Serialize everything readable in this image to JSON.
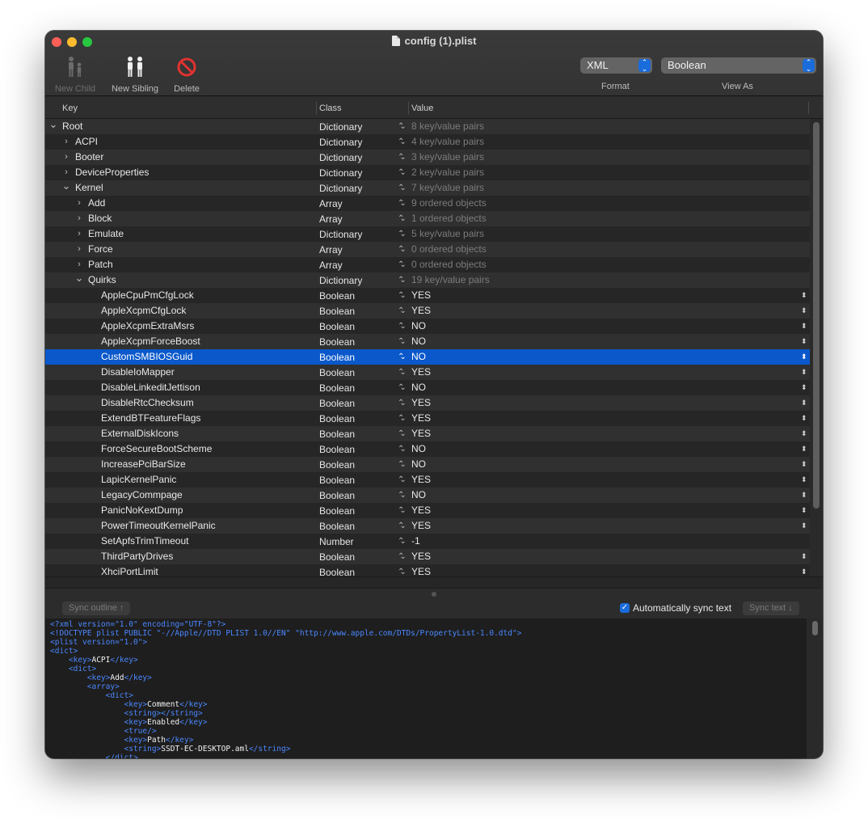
{
  "window": {
    "title": "config (1).plist"
  },
  "toolbar": {
    "new_child": "New Child",
    "new_sibling": "New Sibling",
    "delete": "Delete",
    "format_value": "XML",
    "format_label": "Format",
    "viewas_value": "Boolean",
    "viewas_label": "View As"
  },
  "outline": {
    "headers": {
      "key": "Key",
      "class": "Class",
      "value": "Value"
    },
    "rows": [
      {
        "key": "Root",
        "level": 0,
        "disclosure": "open",
        "class": "Dictionary",
        "value": "8 key/value pairs",
        "muted": true,
        "value_popup": false
      },
      {
        "key": "ACPI",
        "level": 1,
        "disclosure": "closed",
        "class": "Dictionary",
        "value": "4 key/value pairs",
        "muted": true,
        "value_popup": false
      },
      {
        "key": "Booter",
        "level": 1,
        "disclosure": "closed",
        "class": "Dictionary",
        "value": "3 key/value pairs",
        "muted": true,
        "value_popup": false
      },
      {
        "key": "DeviceProperties",
        "level": 1,
        "disclosure": "closed",
        "class": "Dictionary",
        "value": "2 key/value pairs",
        "muted": true,
        "value_popup": false
      },
      {
        "key": "Kernel",
        "level": 1,
        "disclosure": "open",
        "class": "Dictionary",
        "value": "7 key/value pairs",
        "muted": true,
        "value_popup": false
      },
      {
        "key": "Add",
        "level": 2,
        "disclosure": "closed",
        "class": "Array",
        "value": "9 ordered objects",
        "muted": true,
        "value_popup": false
      },
      {
        "key": "Block",
        "level": 2,
        "disclosure": "closed",
        "class": "Array",
        "value": "1 ordered objects",
        "muted": true,
        "value_popup": false
      },
      {
        "key": "Emulate",
        "level": 2,
        "disclosure": "closed",
        "class": "Dictionary",
        "value": "5 key/value pairs",
        "muted": true,
        "value_popup": false
      },
      {
        "key": "Force",
        "level": 2,
        "disclosure": "closed",
        "class": "Array",
        "value": "0 ordered objects",
        "muted": true,
        "value_popup": false
      },
      {
        "key": "Patch",
        "level": 2,
        "disclosure": "closed",
        "class": "Array",
        "value": "0 ordered objects",
        "muted": true,
        "value_popup": false
      },
      {
        "key": "Quirks",
        "level": 2,
        "disclosure": "open",
        "class": "Dictionary",
        "value": "19 key/value pairs",
        "muted": true,
        "value_popup": false
      },
      {
        "key": "AppleCpuPmCfgLock",
        "level": 3,
        "disclosure": "none",
        "class": "Boolean",
        "value": "YES",
        "muted": false,
        "value_popup": true
      },
      {
        "key": "AppleXcpmCfgLock",
        "level": 3,
        "disclosure": "none",
        "class": "Boolean",
        "value": "YES",
        "muted": false,
        "value_popup": true
      },
      {
        "key": "AppleXcpmExtraMsrs",
        "level": 3,
        "disclosure": "none",
        "class": "Boolean",
        "value": "NO",
        "muted": false,
        "value_popup": true
      },
      {
        "key": "AppleXcpmForceBoost",
        "level": 3,
        "disclosure": "none",
        "class": "Boolean",
        "value": "NO",
        "muted": false,
        "value_popup": true
      },
      {
        "key": "CustomSMBIOSGuid",
        "level": 3,
        "disclosure": "none",
        "class": "Boolean",
        "value": "NO",
        "muted": false,
        "value_popup": true,
        "selected": true
      },
      {
        "key": "DisableIoMapper",
        "level": 3,
        "disclosure": "none",
        "class": "Boolean",
        "value": "YES",
        "muted": false,
        "value_popup": true
      },
      {
        "key": "DisableLinkeditJettison",
        "level": 3,
        "disclosure": "none",
        "class": "Boolean",
        "value": "NO",
        "muted": false,
        "value_popup": true
      },
      {
        "key": "DisableRtcChecksum",
        "level": 3,
        "disclosure": "none",
        "class": "Boolean",
        "value": "YES",
        "muted": false,
        "value_popup": true
      },
      {
        "key": "ExtendBTFeatureFlags",
        "level": 3,
        "disclosure": "none",
        "class": "Boolean",
        "value": "YES",
        "muted": false,
        "value_popup": true
      },
      {
        "key": "ExternalDiskIcons",
        "level": 3,
        "disclosure": "none",
        "class": "Boolean",
        "value": "YES",
        "muted": false,
        "value_popup": true
      },
      {
        "key": "ForceSecureBootScheme",
        "level": 3,
        "disclosure": "none",
        "class": "Boolean",
        "value": "NO",
        "muted": false,
        "value_popup": true
      },
      {
        "key": "IncreasePciBarSize",
        "level": 3,
        "disclosure": "none",
        "class": "Boolean",
        "value": "NO",
        "muted": false,
        "value_popup": true
      },
      {
        "key": "LapicKernelPanic",
        "level": 3,
        "disclosure": "none",
        "class": "Boolean",
        "value": "YES",
        "muted": false,
        "value_popup": true
      },
      {
        "key": "LegacyCommpage",
        "level": 3,
        "disclosure": "none",
        "class": "Boolean",
        "value": "NO",
        "muted": false,
        "value_popup": true
      },
      {
        "key": "PanicNoKextDump",
        "level": 3,
        "disclosure": "none",
        "class": "Boolean",
        "value": "YES",
        "muted": false,
        "value_popup": true
      },
      {
        "key": "PowerTimeoutKernelPanic",
        "level": 3,
        "disclosure": "none",
        "class": "Boolean",
        "value": "YES",
        "muted": false,
        "value_popup": true
      },
      {
        "key": "SetApfsTrimTimeout",
        "level": 3,
        "disclosure": "none",
        "class": "Number",
        "value": "-1",
        "muted": false,
        "value_popup": false
      },
      {
        "key": "ThirdPartyDrives",
        "level": 3,
        "disclosure": "none",
        "class": "Boolean",
        "value": "YES",
        "muted": false,
        "value_popup": true
      },
      {
        "key": "XhciPortLimit",
        "level": 3,
        "disclosure": "none",
        "class": "Boolean",
        "value": "YES",
        "muted": false,
        "value_popup": true
      }
    ]
  },
  "sync": {
    "sync_outline": "Sync outline ↑",
    "auto_sync_label": "Automatically sync text",
    "auto_sync_checked": true,
    "sync_text": "Sync text ↓"
  },
  "xml_lines": [
    [
      [
        "tag",
        "<?xml version=\"1.0\" encoding=\"UTF-8\"?>"
      ]
    ],
    [
      [
        "tag",
        "<!DOCTYPE plist PUBLIC \"-//Apple//DTD PLIST 1.0//EN\" \"http://www.apple.com/DTDs/PropertyList-1.0.dtd\">"
      ]
    ],
    [
      [
        "tag",
        "<plist version=\"1.0\">"
      ]
    ],
    [
      [
        "tag",
        "<dict>"
      ]
    ],
    [
      [
        "tag",
        "    <key>"
      ],
      [
        "txt",
        "ACPI"
      ],
      [
        "tag",
        "</key>"
      ]
    ],
    [
      [
        "tag",
        "    <dict>"
      ]
    ],
    [
      [
        "tag",
        "        <key>"
      ],
      [
        "txt",
        "Add"
      ],
      [
        "tag",
        "</key>"
      ]
    ],
    [
      [
        "tag",
        "        <array>"
      ]
    ],
    [
      [
        "tag",
        "            <dict>"
      ]
    ],
    [
      [
        "tag",
        "                <key>"
      ],
      [
        "txt",
        "Comment"
      ],
      [
        "tag",
        "</key>"
      ]
    ],
    [
      [
        "tag",
        "                <string></string>"
      ]
    ],
    [
      [
        "tag",
        "                <key>"
      ],
      [
        "txt",
        "Enabled"
      ],
      [
        "tag",
        "</key>"
      ]
    ],
    [
      [
        "tag",
        "                <true/>"
      ]
    ],
    [
      [
        "tag",
        "                <key>"
      ],
      [
        "txt",
        "Path"
      ],
      [
        "tag",
        "</key>"
      ]
    ],
    [
      [
        "tag",
        "                <string>"
      ],
      [
        "txt",
        "SSDT-EC-DESKTOP.aml"
      ],
      [
        "tag",
        "</string>"
      ]
    ],
    [
      [
        "tag",
        "            </dict>"
      ]
    ]
  ],
  "colors": {
    "selection": "#0a58ca",
    "xml_tag": "#4b87ff",
    "accent": "#1a6cdb"
  }
}
